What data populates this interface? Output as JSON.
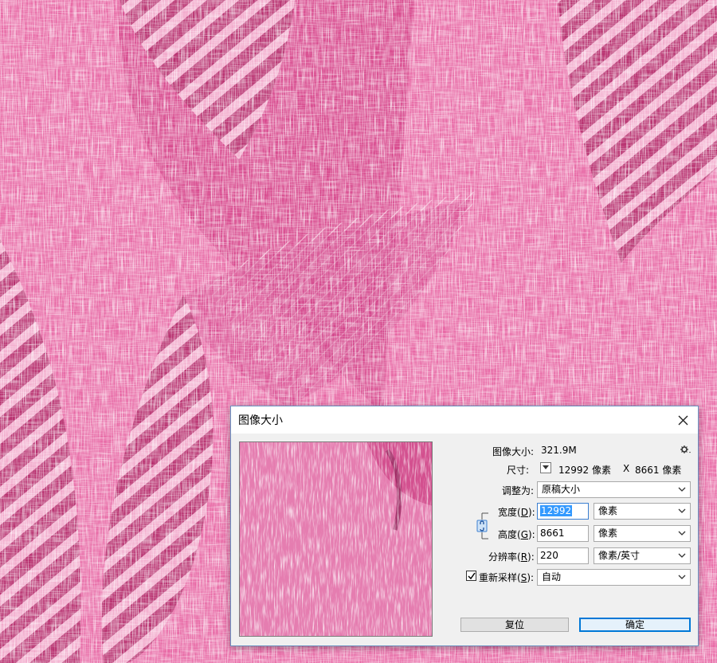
{
  "dialog": {
    "title": "图像大小",
    "image_size_label": "图像大小:",
    "image_size_value": "321.9M",
    "dimensions_label": "尺寸:",
    "dimensions_width": "12992 像素",
    "dimensions_sep": "X",
    "dimensions_height": "8661 像素",
    "fit_to_label": "调整为:",
    "fit_to_value": "原稿大小",
    "width_label_pre": "宽度(",
    "width_key": "D",
    "width_label_post": "):",
    "width_value": "12992",
    "width_unit": "像素",
    "height_label_pre": "高度(",
    "height_key": "G",
    "height_label_post": "):",
    "height_value": "8661",
    "height_unit": "像素",
    "resolution_label_pre": "分辨率(",
    "resolution_key": "R",
    "resolution_label_post": "):",
    "resolution_value": "220",
    "resolution_unit": "像素/英寸",
    "resample_label_pre": "重新采样(",
    "resample_key": "S",
    "resample_label_post": "):",
    "resample_checked": true,
    "resample_value": "自动",
    "reset_button": "复位",
    "ok_button": "确定"
  },
  "colors": {
    "background_pink": "#e0569a",
    "dark_magenta": "#9c2461",
    "accent_blue": "#0078d7"
  },
  "icons": [
    "close-icon",
    "gear-icon",
    "chevron-down-icon",
    "link-icon",
    "checkmark-icon"
  ]
}
